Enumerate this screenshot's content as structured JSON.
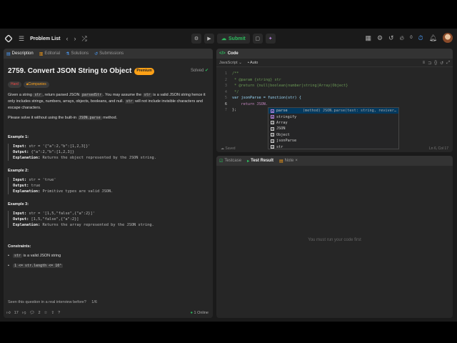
{
  "topbar": {
    "problem_list_label": "Problem List",
    "submit_label": "Submit",
    "streak_count": "0"
  },
  "left_tabs": [
    {
      "label": "Description"
    },
    {
      "label": "Editorial"
    },
    {
      "label": "Solutions"
    },
    {
      "label": "Submissions"
    }
  ],
  "problem": {
    "title": "2759. Convert JSON String to Object",
    "premium_label": "Premium",
    "solved_label": "Solved",
    "difficulty": "Hard",
    "companies_label": "Companies",
    "desc_1a": "Given a string ",
    "desc_1b": "str",
    "desc_1c": ", return parsed JSON ",
    "desc_1d": "parsedStr",
    "desc_1e": ". You may assume the ",
    "desc_1f": "str",
    "desc_1g": " is a valid JSON string hence it only includes strings, numbers, arrays, objects, booleans, and null. ",
    "desc_1h": "str",
    "desc_1i": " will not include invisible characters and escape characters.",
    "desc_2a": "Please solve it without using the built-in ",
    "desc_2b": "JSON.parse",
    "desc_2c": " method."
  },
  "examples": [
    {
      "title": "Example 1:",
      "input": "str = '{\"a\":2,\"b\":[1,2,3]}'",
      "output": "{\"a\":2,\"b\":[1,2,3]}",
      "explanation": "Returns the object represented by the JSON string."
    },
    {
      "title": "Example 2:",
      "input": "str = 'true'",
      "output": "true",
      "explanation": "Primitive types are valid JSON."
    },
    {
      "title": "Example 3:",
      "input": "str = '[1,5,\"false\",{\"a\":2}]'",
      "output": "[1,5,\"false\",{\"a\":2}]",
      "explanation": "Returns the array represented by the JSON string."
    }
  ],
  "labels": {
    "input": "Input:",
    "output": "Output:",
    "explanation": "Explanation:"
  },
  "constraints": {
    "title": "Constraints:",
    "item_1_code": "str",
    "item_1_text": " is a valid JSON string",
    "item_2_code": "1 <= str.length <= 10⁵"
  },
  "footer": {
    "seen_question": "Seen this question in a real interview before?",
    "page_indicator": "1/6",
    "likes": "17",
    "comments": "2",
    "online": "1 Online"
  },
  "code": {
    "title": "Code",
    "language": "JavaScript",
    "auto_label": "Auto",
    "lines": [
      "/**",
      " * @param {string} str",
      " * @return {null|boolean|number|string|Array|Object}",
      " */",
      "var jsonParse = function(str) {",
      "    return JSON.",
      "};"
    ],
    "saved_label": "Saved",
    "cursor_position": "Ln 6, Col 17"
  },
  "suggestions": [
    {
      "label": "parse",
      "detail": "(method) JSON.parse(text: string, reviver…"
    },
    {
      "label": "stringify",
      "detail": ""
    },
    {
      "label": "Array",
      "detail": ""
    },
    {
      "label": "JSON",
      "detail": ""
    },
    {
      "label": "Object",
      "detail": ""
    },
    {
      "label": "jsonParse",
      "detail": ""
    },
    {
      "label": "str",
      "detail": ""
    }
  ],
  "test_tabs": [
    {
      "label": "Testcase"
    },
    {
      "label": "Test Result"
    },
    {
      "label": "Note"
    }
  ],
  "test_message": "You must run your code first"
}
